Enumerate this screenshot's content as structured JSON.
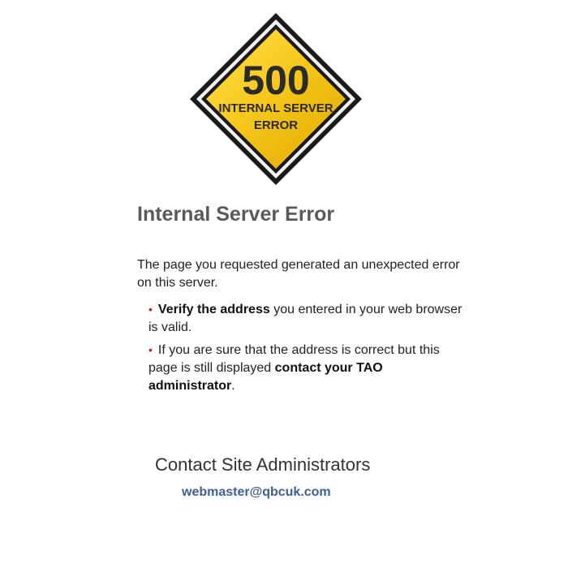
{
  "sign": {
    "code": "500",
    "line1": "INTERNAL SERVER",
    "line2": "ERROR"
  },
  "colors": {
    "sign_yellow": "#f5c518",
    "sign_border": "#1a1a1a",
    "title": "#5a5a5a",
    "bullet": "#b5242a",
    "link": "#3f5f95"
  },
  "content": {
    "title": "Internal Server Error",
    "intro": "The page you requested generated an unexpected error on this server.",
    "tips": [
      {
        "bold": "Verify the address",
        "text": " you entered in your web browser is valid."
      },
      {
        "text": "If you are sure that the address is correct but this page is still displayed ",
        "bold": "contact your TAO administrator",
        "after": "."
      }
    ]
  },
  "contact": {
    "title": "Contact Site Administrators",
    "email": "webmaster@qbcuk.com"
  }
}
